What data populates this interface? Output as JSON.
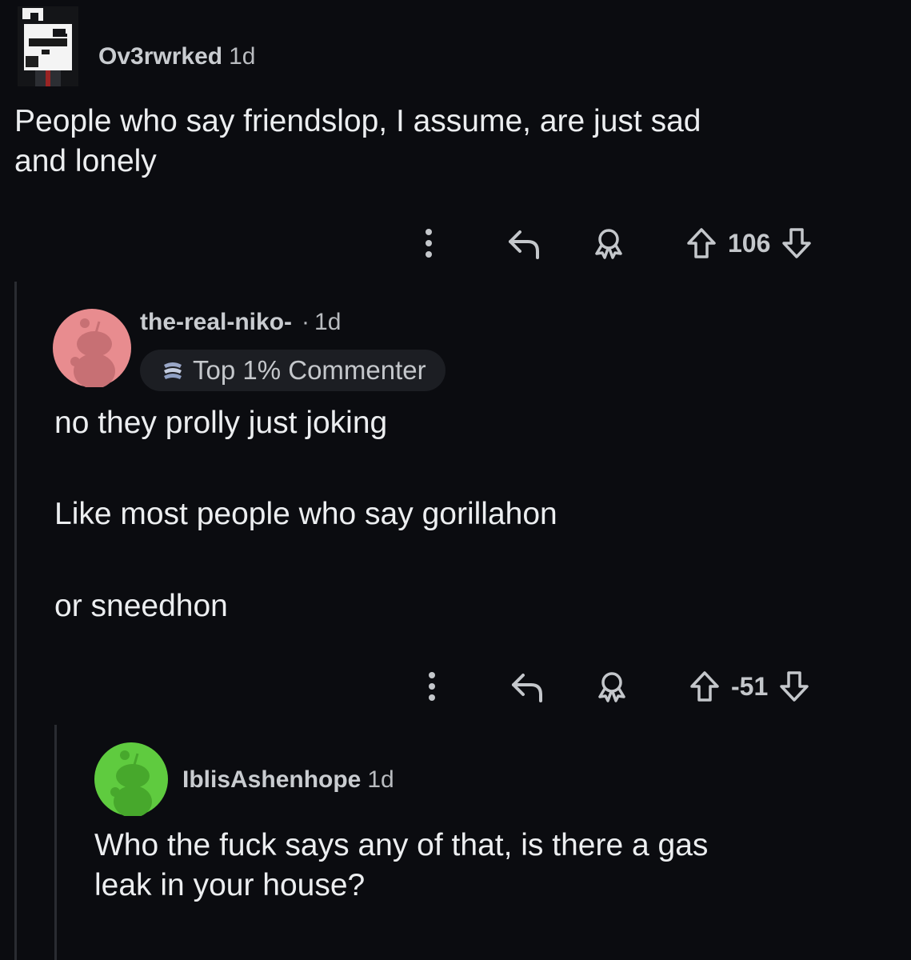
{
  "comments": [
    {
      "username": "Ov3rwrked",
      "time": "1d",
      "body": [
        "People who say friendslop, I assume, are just sad",
        "and lonely"
      ],
      "votes": "106"
    },
    {
      "username": "the-real-niko-",
      "separator": "·",
      "time": "1d",
      "badge": "Top 1% Commenter",
      "body": [
        "no they prolly just joking",
        "Like most people who say gorillahon",
        "or sneedhon"
      ],
      "votes": "-51"
    },
    {
      "username": "IblisAshenhope",
      "time": "1d",
      "body": [
        "Who the fuck says any of that, is there a gas",
        "leak in your house?"
      ]
    }
  ],
  "icons": {
    "more": "more-options-icon",
    "reply": "reply-icon",
    "award": "award-icon",
    "upvote": "upvote-icon",
    "downvote": "downvote-icon"
  },
  "colors": {
    "background": "#0b0c10",
    "avatar_pink": "#e88c8f",
    "avatar_green": "#5fcb3f",
    "text": "#eceef0",
    "muted": "#c4c7cb"
  }
}
